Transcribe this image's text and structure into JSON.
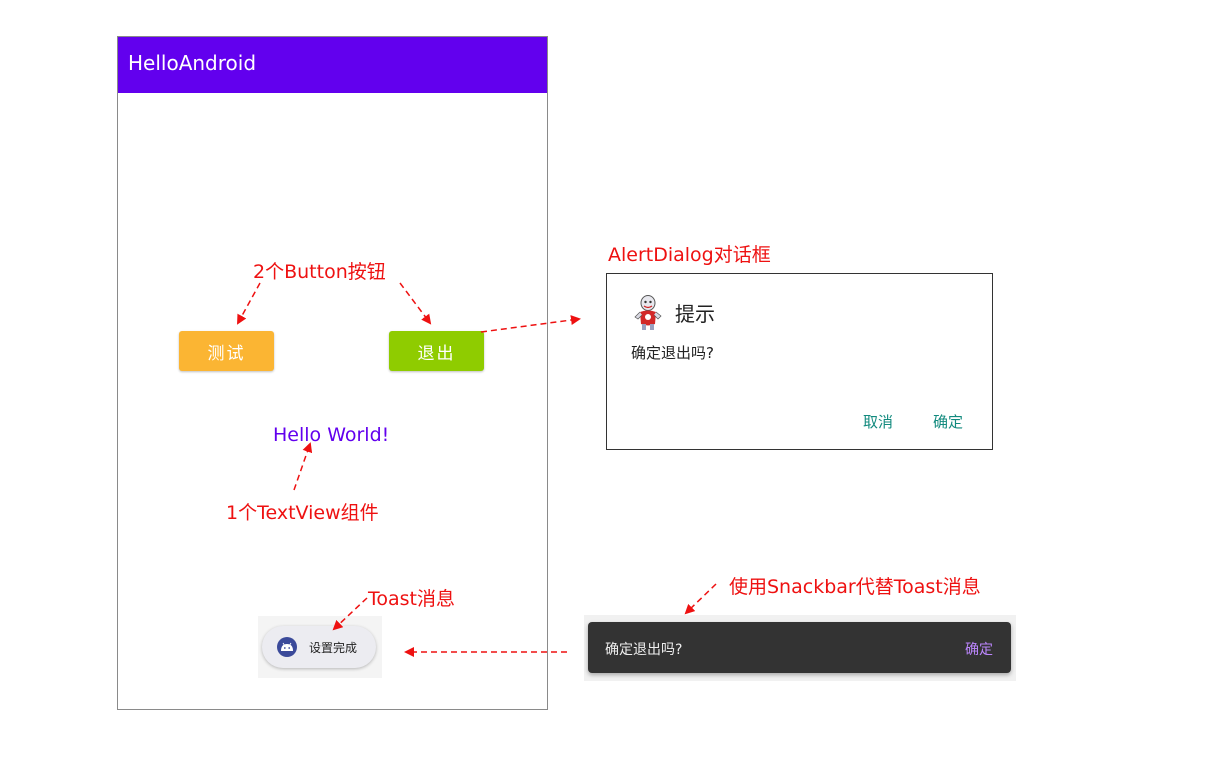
{
  "app": {
    "title": "HelloAndroid"
  },
  "buttons": {
    "test_label": "测试",
    "exit_label": "退出"
  },
  "textview": {
    "text": "Hello World!"
  },
  "toast": {
    "text": "设置完成",
    "icon": "android-icon"
  },
  "annotations": {
    "buttons": "2个Button按钮",
    "textview": "1个TextView组件",
    "toast": "Toast消息",
    "dialog": "AlertDialog对话框",
    "snackbar": "使用Snackbar代替Toast消息"
  },
  "dialog": {
    "title": "提示",
    "message": "确定退出吗?",
    "cancel_label": "取消",
    "ok_label": "确定"
  },
  "snackbar": {
    "message": "确定退出吗?",
    "action_label": "确定"
  },
  "colors": {
    "app_bar": "#6200ee",
    "test_button": "#fbb533",
    "exit_button": "#8fcc00",
    "annotation": "#ee1111",
    "dialog_button": "#128a7e",
    "snackbar_bg": "#333333",
    "snackbar_action": "#bb86fc"
  }
}
